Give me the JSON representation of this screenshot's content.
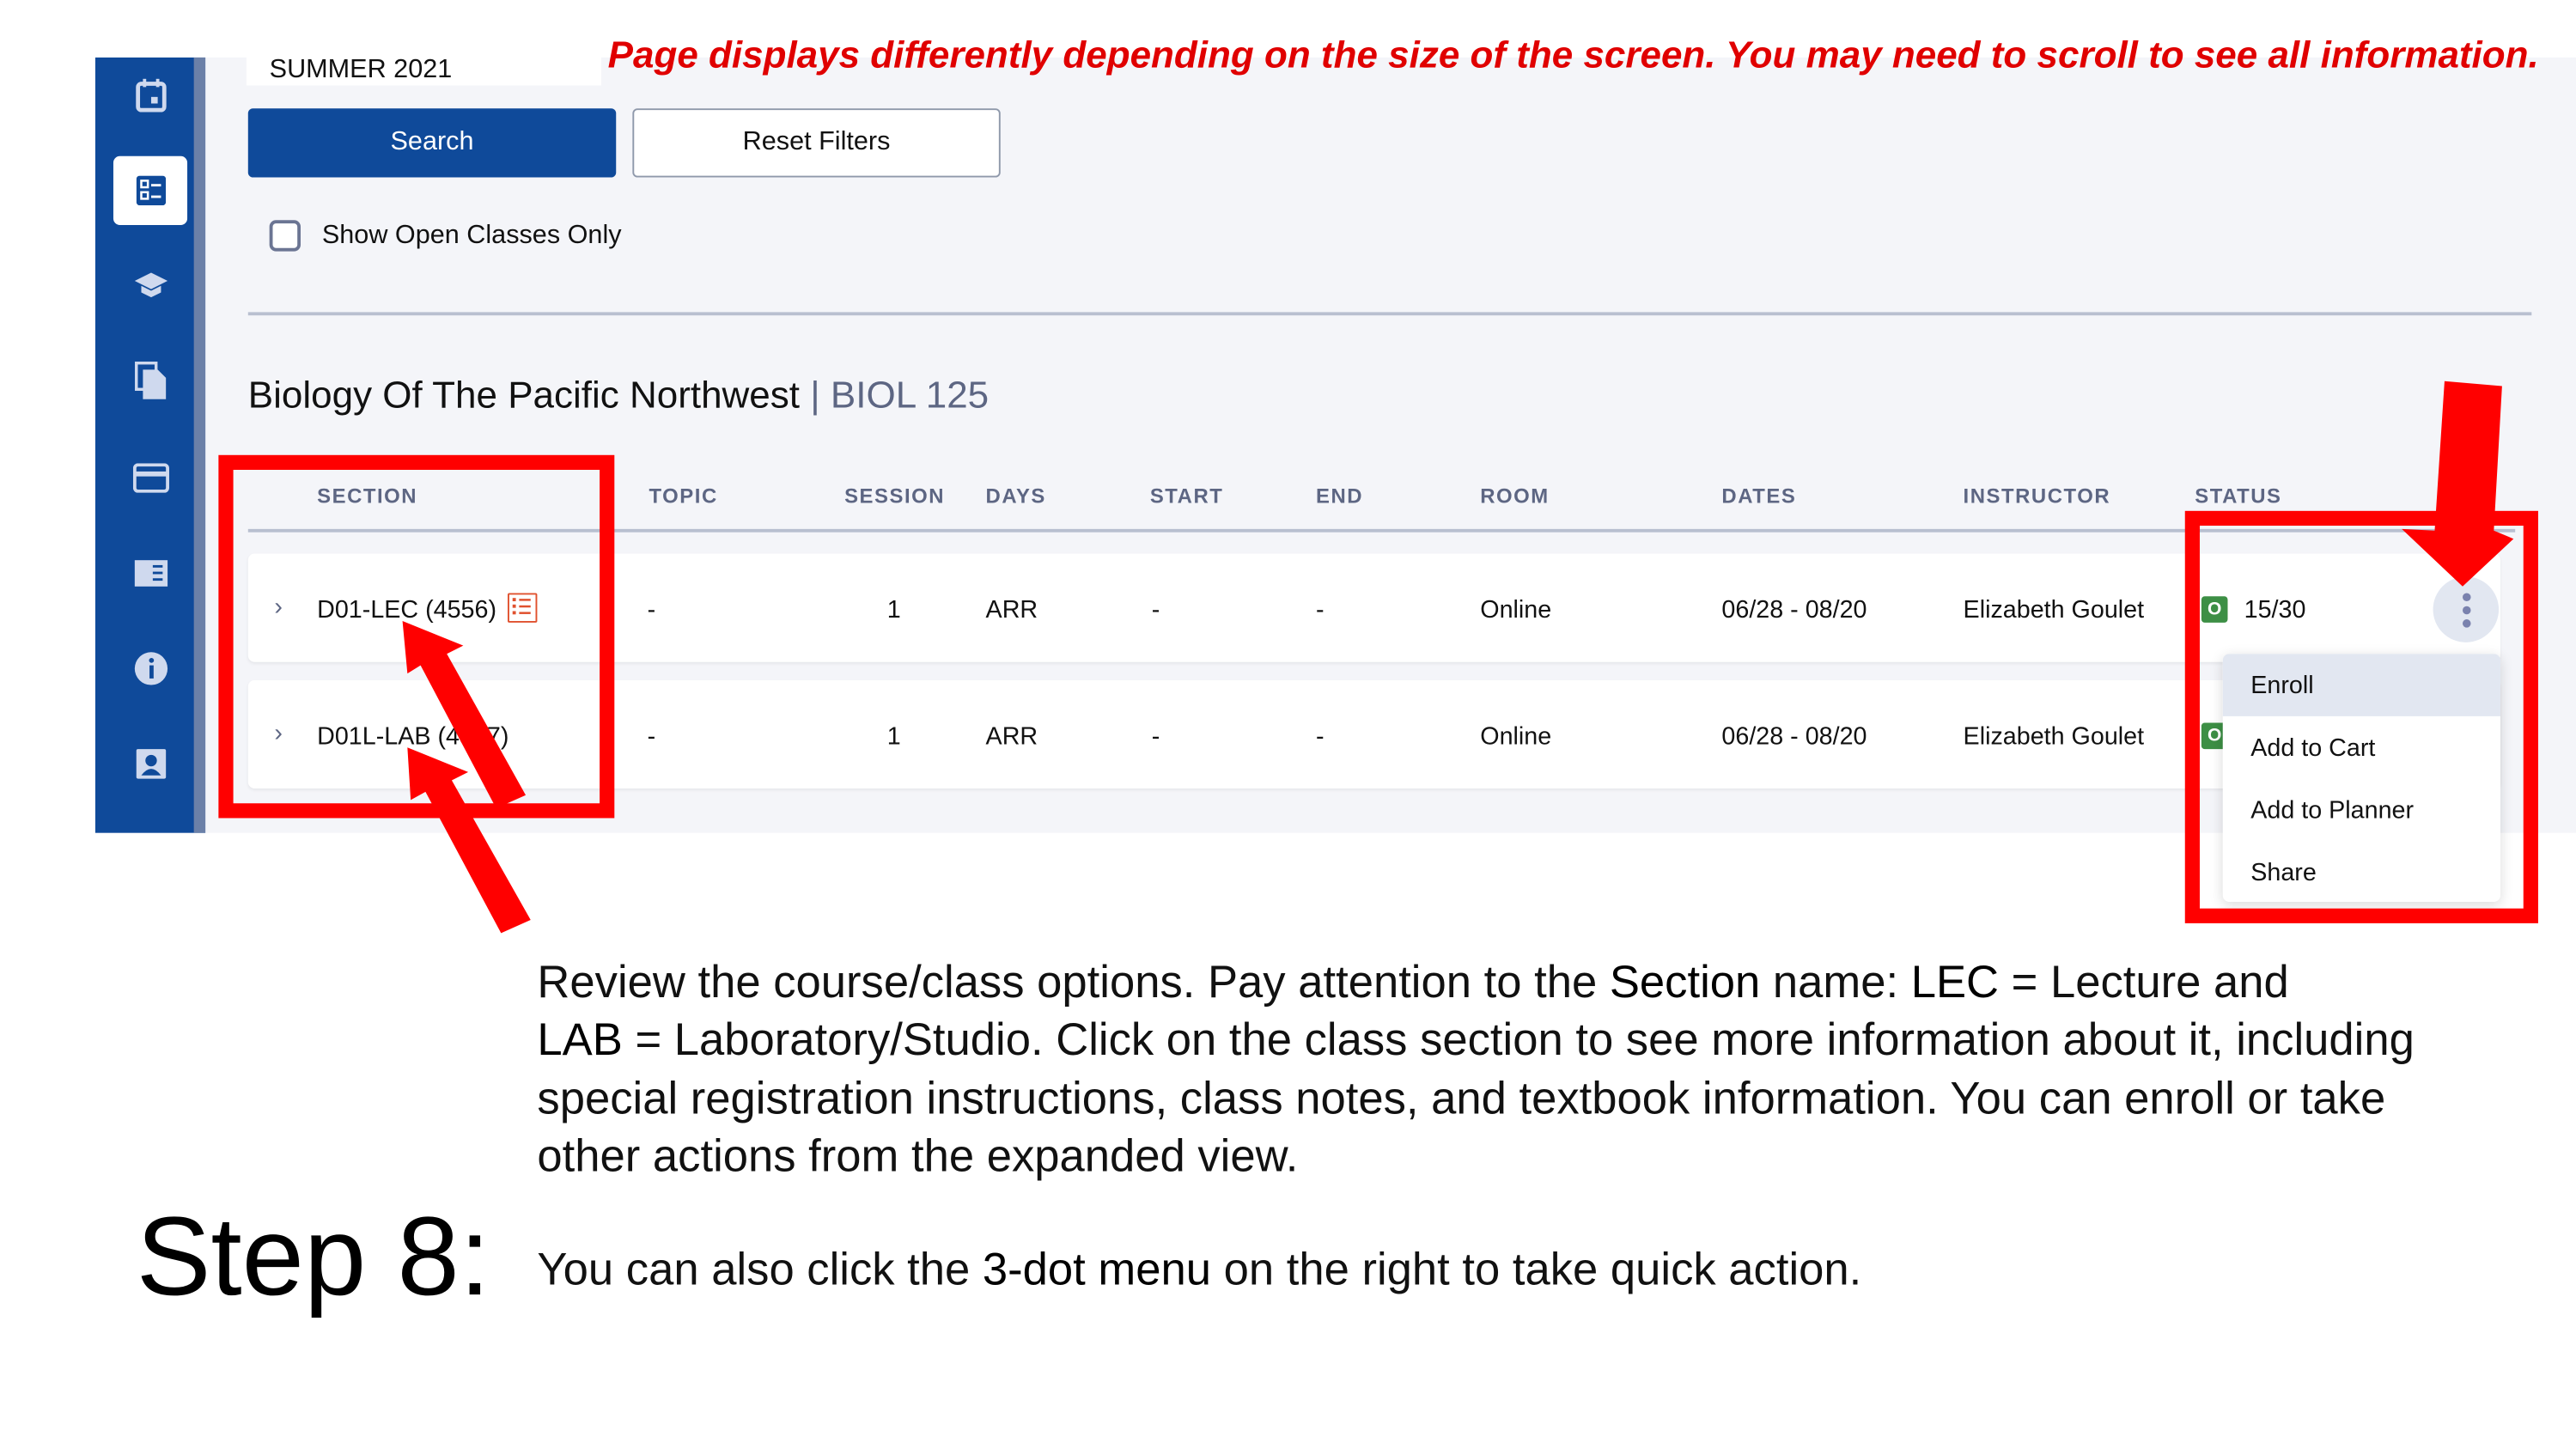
{
  "notice": "Page displays differently depending on the size of the screen. You may need to scroll to see all information.",
  "term": "SUMMER 2021",
  "buttons": {
    "search": "Search",
    "reset": "Reset Filters"
  },
  "filter": {
    "label": "Show Open Classes Only",
    "checked": false
  },
  "sidebar": {
    "items": [
      "calendar-icon",
      "class-search-icon",
      "graduation-cap-icon",
      "documents-icon",
      "credit-card-icon",
      "catalog-icon",
      "info-icon",
      "profile-icon"
    ],
    "active": 1
  },
  "course": {
    "name": "Biology Of The Pacific Northwest",
    "separator": "|",
    "code": "BIOL 125"
  },
  "table": {
    "headers": [
      "SECTION",
      "TOPIC",
      "SESSION",
      "DAYS",
      "START",
      "END",
      "ROOM",
      "DATES",
      "INSTRUCTOR",
      "STATUS"
    ],
    "rows": [
      {
        "section": "D01-LEC (4556)",
        "topic": "-",
        "session": "1",
        "days": "ARR",
        "start": "-",
        "end": "-",
        "room": "Online",
        "dates": "06/28 - 08/20",
        "instructor": "Elizabeth Goulet",
        "status_badge": "O",
        "seats": "15/30"
      },
      {
        "section": "D01L-LAB (4557)",
        "topic": "-",
        "session": "1",
        "days": "ARR",
        "start": "-",
        "end": "-",
        "room": "Online",
        "dates": "06/28 - 08/20",
        "instructor": "Elizabeth Goulet",
        "status_badge": "O",
        "seats": ""
      }
    ]
  },
  "menu": {
    "items": [
      "Enroll",
      "Add to Cart",
      "Add to Planner",
      "Share"
    ],
    "highlighted": "Enroll"
  },
  "colors": {
    "brand": "#0f4a9a",
    "open": "#3d8f45",
    "annotation": "#ff0000"
  },
  "instructions": {
    "p1": "Review the course/class options. Pay attention to the ",
    "p1_section": "Section",
    "p2": " name: ",
    "p2_lec": "LEC",
    "p3": " = Lecture and ",
    "p3_lab": "LAB",
    "p4": " = Laboratory/Studio. Click on the class section to see more information about it, including special registration instructions, class notes, and textbook information. You can enroll or take other actions from the expanded view.",
    "step": "Step 8:",
    "s1": "You can also click the ",
    "s1_menu": "3-dot menu",
    "s2": " on the right to take quick action."
  }
}
